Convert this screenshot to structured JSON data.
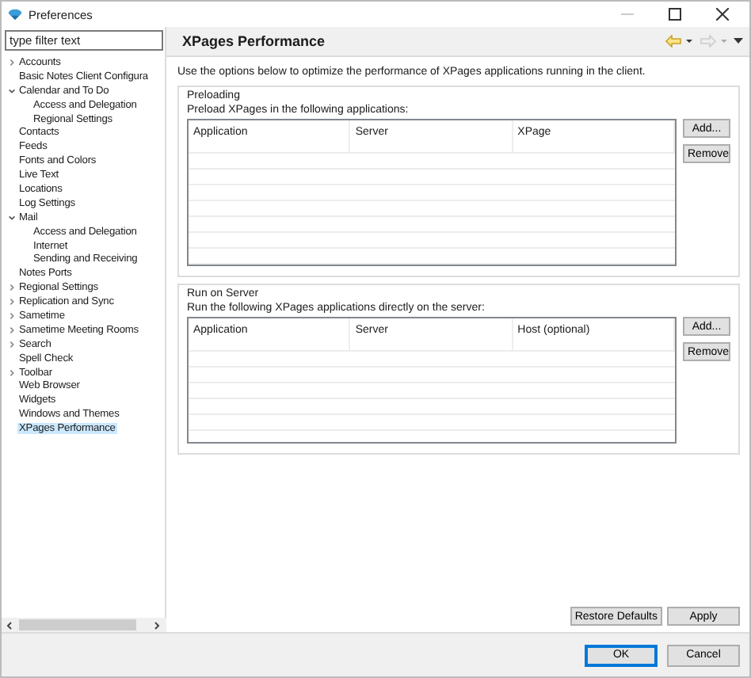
{
  "window": {
    "title": "Preferences"
  },
  "filter": {
    "placeholder": "type filter text"
  },
  "tree": [
    {
      "label": "Accounts",
      "expanded": false,
      "selected": false
    },
    {
      "label": "Basic Notes Client Configura",
      "selected": false
    },
    {
      "label": "Calendar and To Do",
      "expanded": true,
      "selected": false,
      "children": [
        {
          "label": "Access and Delegation",
          "selected": false
        },
        {
          "label": "Regional Settings",
          "selected": false
        }
      ]
    },
    {
      "label": "Contacts",
      "selected": false
    },
    {
      "label": "Feeds",
      "selected": false
    },
    {
      "label": "Fonts and Colors",
      "selected": false
    },
    {
      "label": "Live Text",
      "selected": false
    },
    {
      "label": "Locations",
      "selected": false
    },
    {
      "label": "Log Settings",
      "selected": false
    },
    {
      "label": "Mail",
      "expanded": true,
      "selected": false,
      "children": [
        {
          "label": "Access and Delegation",
          "selected": false
        },
        {
          "label": "Internet",
          "selected": false
        },
        {
          "label": "Sending and Receiving",
          "selected": false
        }
      ]
    },
    {
      "label": "Notes Ports",
      "selected": false
    },
    {
      "label": "Regional Settings",
      "expanded": false,
      "selected": false
    },
    {
      "label": "Replication and Sync",
      "expanded": false,
      "selected": false
    },
    {
      "label": "Sametime",
      "expanded": false,
      "selected": false
    },
    {
      "label": "Sametime Meeting Rooms",
      "expanded": false,
      "selected": false
    },
    {
      "label": "Search",
      "expanded": false,
      "selected": false
    },
    {
      "label": "Spell Check",
      "selected": false
    },
    {
      "label": "Toolbar",
      "expanded": false,
      "selected": false
    },
    {
      "label": "Web Browser",
      "selected": false
    },
    {
      "label": "Widgets",
      "selected": false
    },
    {
      "label": "Windows and Themes",
      "selected": false
    },
    {
      "label": "XPages Performance",
      "selected": true
    }
  ],
  "page": {
    "title": "XPages Performance",
    "description": "Use the options below to optimize the performance of XPages applications running in the client.",
    "groups": [
      {
        "title": "Preloading",
        "caption": "Preload XPages in the following applications:",
        "columns": [
          "Application",
          "Server",
          "XPage"
        ],
        "buttons": [
          "Add...",
          "Remove"
        ]
      },
      {
        "title": "Run on Server",
        "caption": "Run the following XPages applications directly on the server:",
        "columns": [
          "Application",
          "Server",
          "Host (optional)"
        ],
        "buttons": [
          "Add...",
          "Remove"
        ]
      }
    ],
    "buttons": [
      "Restore Defaults",
      "Apply"
    ]
  },
  "dialog_buttons": [
    {
      "label": "OK",
      "default": true
    },
    {
      "label": "Cancel",
      "default": false
    }
  ]
}
